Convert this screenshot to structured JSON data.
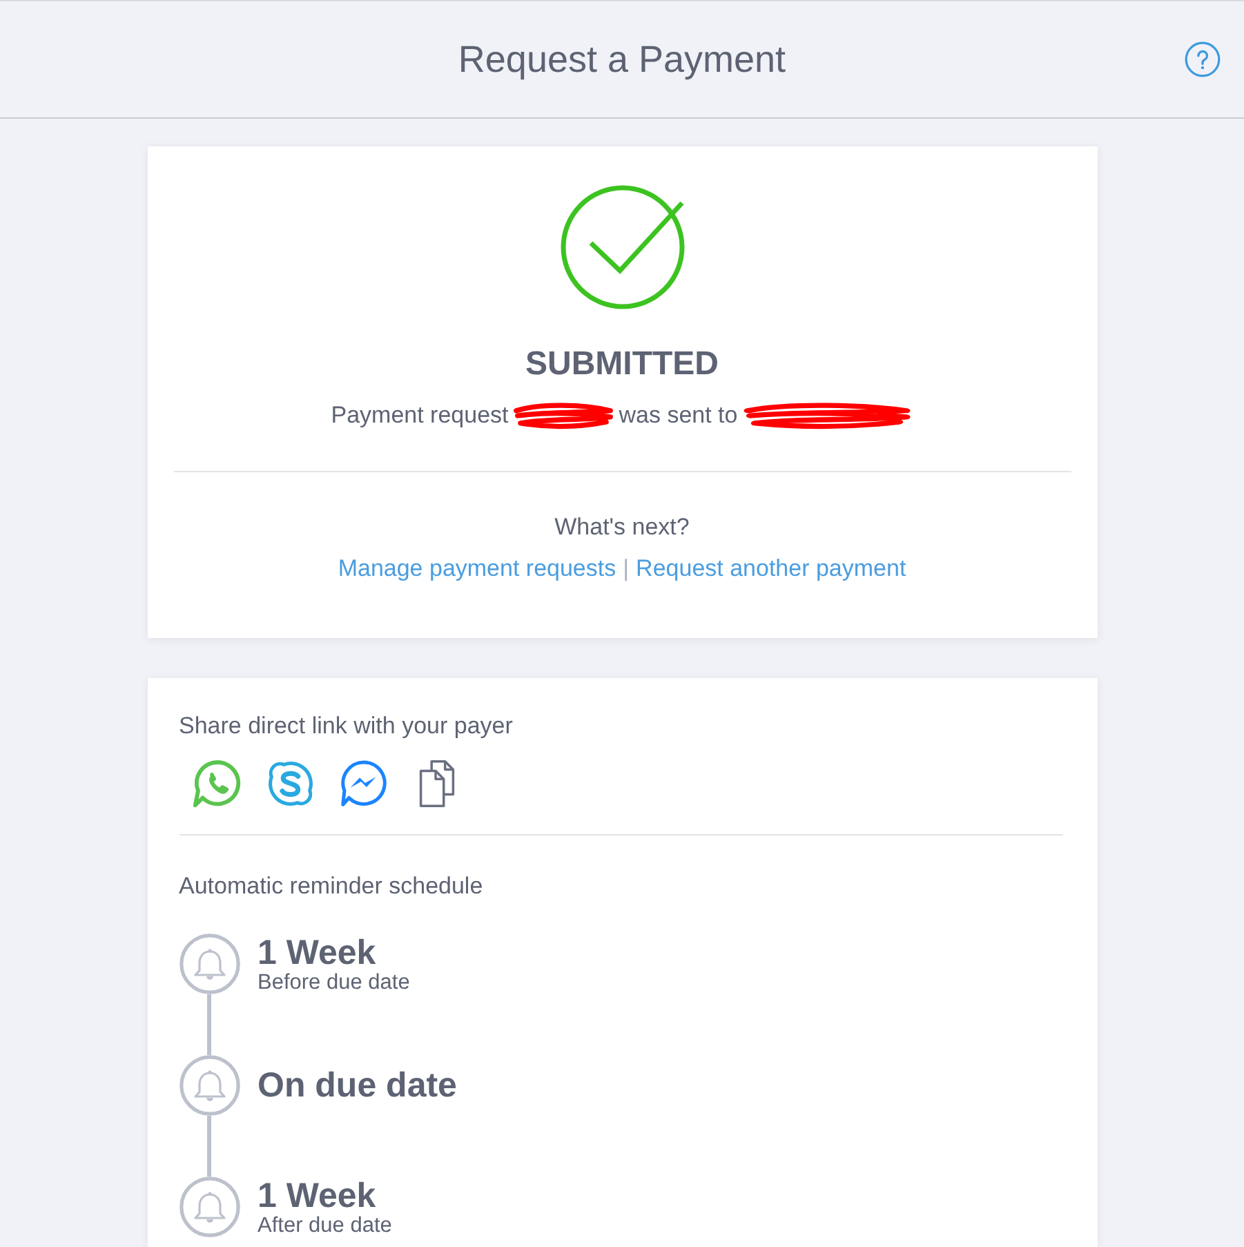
{
  "header": {
    "title": "Request a Payment"
  },
  "status": {
    "kind": "success",
    "title": "SUBMITTED",
    "message": [
      {
        "kind": "text",
        "text": "Payment request"
      },
      {
        "kind": "redacted"
      },
      {
        "kind": "text",
        "text": "was sent to"
      },
      {
        "kind": "redacted"
      }
    ]
  },
  "next_steps": {
    "heading": "What's next?",
    "links": [
      "Manage payment requests",
      "Request another payment"
    ],
    "separator": "|"
  },
  "share": {
    "heading": "Share direct link with your payer",
    "options": [
      {
        "kind": "phone"
      },
      {
        "kind": "letter"
      },
      {
        "kind": "lightning"
      },
      {
        "kind": "pages"
      }
    ]
  },
  "reminders": {
    "heading": "Automatic reminder schedule",
    "items": [
      {
        "title": "1 Week",
        "subtitle": "Before due date"
      },
      {
        "title": "On due date"
      },
      {
        "title": "1 Week",
        "subtitle": "After due date"
      }
    ]
  }
}
